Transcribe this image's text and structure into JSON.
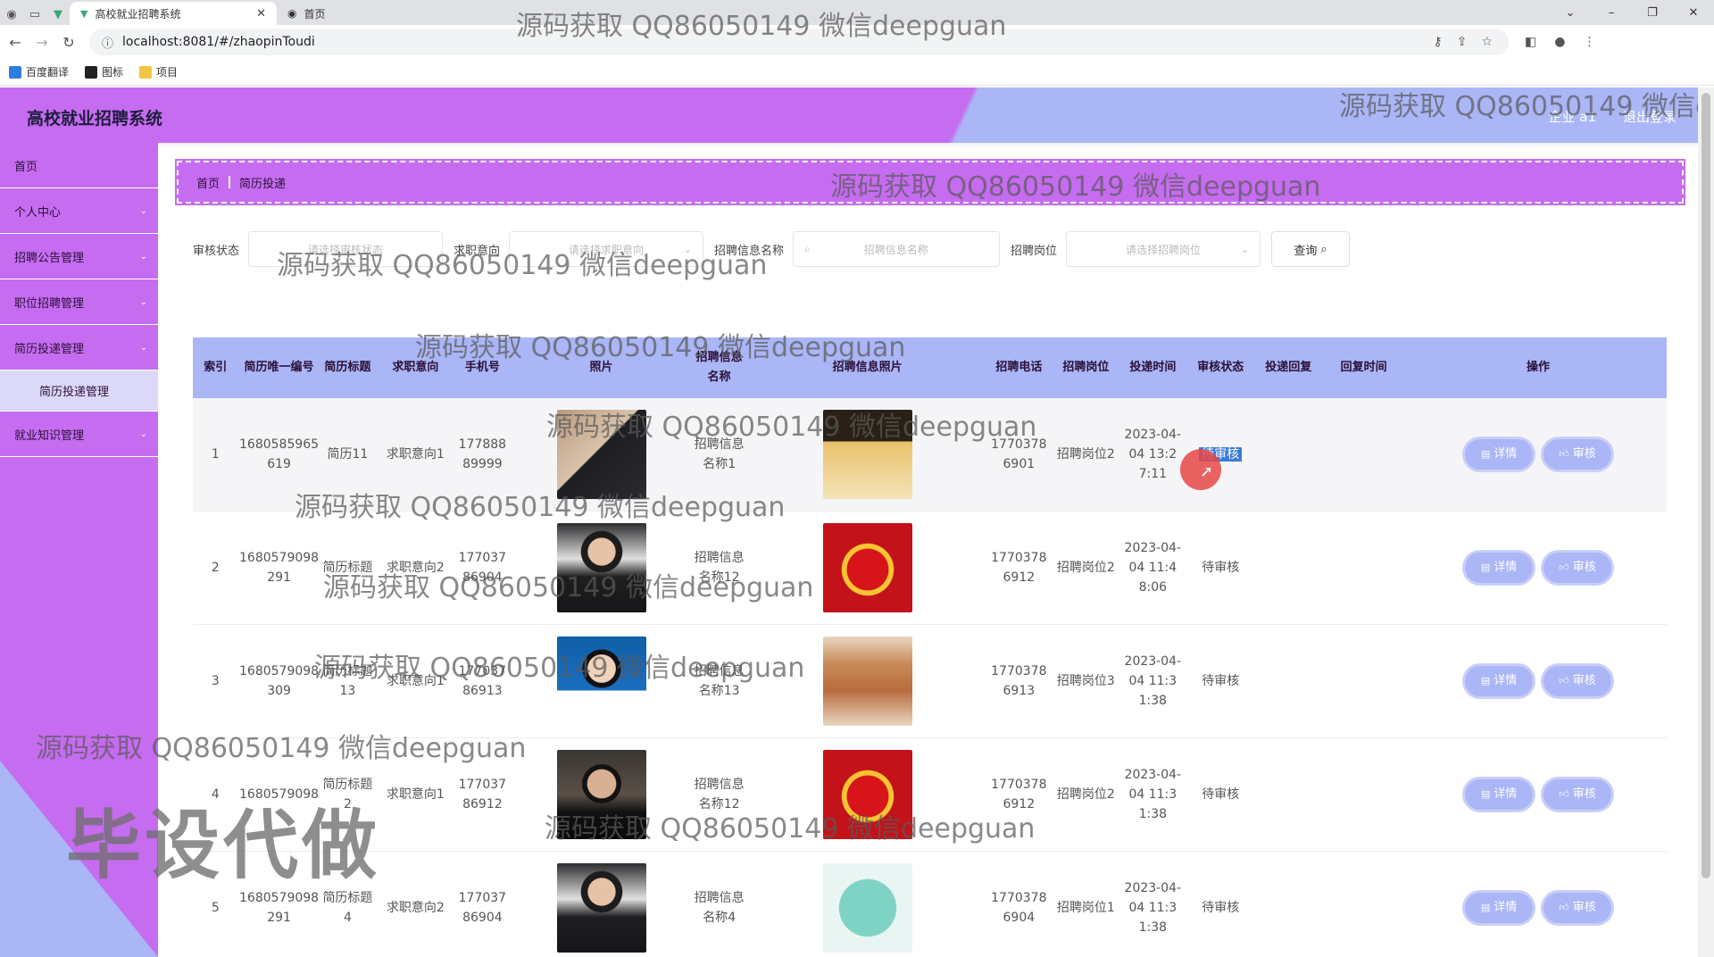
{
  "browser": {
    "tabs": [
      {
        "title": "高校就业招聘系统",
        "active": true
      },
      {
        "title": "首页",
        "active": false
      }
    ],
    "url": "localhost:8081/#/zhaopinToudi",
    "bookmarks": [
      "百度翻译",
      "图标",
      "项目"
    ]
  },
  "header": {
    "title": "高校就业招聘系统",
    "user": "企业 a1",
    "logout": "退出登录"
  },
  "sidebar": {
    "items": [
      {
        "label": "首页",
        "expandable": false
      },
      {
        "label": "个人中心",
        "expandable": true
      },
      {
        "label": "招聘公告管理",
        "expandable": true
      },
      {
        "label": "职位招聘管理",
        "expandable": true
      },
      {
        "label": "简历投递管理",
        "expandable": true
      },
      {
        "label": "简历投递管理",
        "sub": true
      },
      {
        "label": "就业知识管理",
        "expandable": true
      }
    ]
  },
  "breadcrumb": {
    "home": "首页",
    "current": "简历投递"
  },
  "filters": {
    "status_label": "审核状态",
    "status_placeholder": "请选择审核状态",
    "intent_label": "求职意向",
    "intent_placeholder": "请选择求职意向",
    "name_label": "招聘信息名称",
    "name_placeholder": "招聘信息名称",
    "post_label": "招聘岗位",
    "post_placeholder": "请选择招聘岗位",
    "query_button": "查询"
  },
  "table": {
    "headers": [
      "索引",
      "简历唯一编号",
      "简历标题",
      "求职意向",
      "手机号",
      "照片",
      "招聘信息名称",
      "招聘信息照片",
      "招聘电话",
      "招聘岗位",
      "投递时间",
      "审核状态",
      "投递回复",
      "回复时间",
      "操作"
    ],
    "rows": [
      {
        "index": "1",
        "resume_id": "1680585965619",
        "title": "简历11",
        "intent": "求职意向1",
        "phone": "17788889999",
        "job_name": "招聘信息名称1",
        "tel": "17703786901",
        "post": "招聘岗位2",
        "time": "2023-04-04 13:27:11",
        "status": "待审核",
        "reply": "",
        "reply_time": "",
        "photo": "woman-back",
        "poster": "poster-dark"
      },
      {
        "index": "2",
        "resume_id": "1680579098291",
        "title": "简历标题",
        "intent": "求职意向2",
        "phone": "17703786904",
        "job_name": "招聘信息名称12",
        "tel": "17703786912",
        "post": "招聘岗位2",
        "time": "2023-04-04 11:48:06",
        "status": "待审核",
        "reply": "",
        "reply_time": "",
        "photo": "man-suit",
        "poster": "poster-red"
      },
      {
        "index": "3",
        "resume_id": "1680579098309",
        "title": "简历标题13",
        "intent": "求职意向1",
        "phone": "17703786913",
        "job_name": "招聘信息名称13",
        "tel": "17703786913",
        "post": "招聘岗位3",
        "time": "2023-04-04 11:31:38",
        "status": "待审核",
        "reply": "",
        "reply_time": "",
        "photo": "man-blue",
        "poster": "poster-beige"
      },
      {
        "index": "4",
        "resume_id": "1680579098",
        "title": "简历标题2",
        "intent": "求职意向1",
        "phone": "17703786912",
        "job_name": "招聘信息名称12",
        "tel": "17703786912",
        "post": "招聘岗位2",
        "time": "2023-04-04 11:31:38",
        "status": "待审核",
        "reply": "",
        "reply_time": "",
        "photo": "man-room",
        "poster": "poster-red"
      },
      {
        "index": "5",
        "resume_id": "1680579098291",
        "title": "简历标题4",
        "intent": "求职意向2",
        "phone": "17703786904",
        "job_name": "招聘信息名称4",
        "tel": "17703786904",
        "post": "招聘岗位1",
        "time": "2023-04-04 11:31:38",
        "status": "待审核",
        "reply": "",
        "reply_time": "",
        "photo": "man-suit",
        "poster": "poster-teal"
      }
    ],
    "detail_button": "详情",
    "audit_button": "审核"
  },
  "watermarks": {
    "text": "源码获取 QQ86050149 微信deepguan",
    "text_cut": "源码获取 QQ86050149 微信de",
    "big": "毕设代做"
  },
  "colors": {
    "purple": "#c66cf0",
    "lavender": "#aab6f6",
    "status_highlight": "#3a7bdc"
  }
}
